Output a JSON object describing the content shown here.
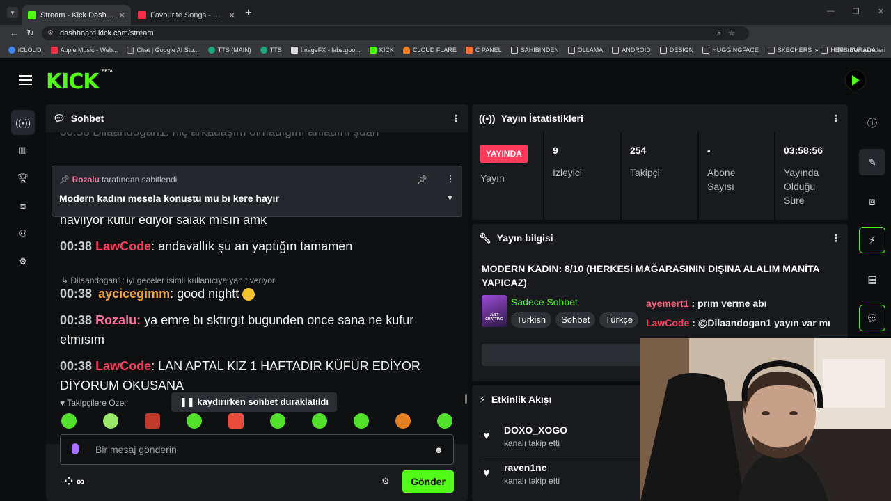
{
  "browser": {
    "tabs": [
      {
        "title": "Stream - Kick Dashboard",
        "active": true
      },
      {
        "title": "Favourite Songs - Playlist - App",
        "active": false
      }
    ],
    "url": "dashboard.kick.com/stream",
    "bookmarks": [
      "iCLOUD",
      "Apple Music - Web...",
      "Chat | Google AI Stu...",
      "TTS (MAIN)",
      "TTS",
      "ImageFX - labs.goo...",
      "KICK",
      "CLOUD FLARE",
      "C PANEL",
      "SAHIBINDEN",
      "OLLAMA",
      "ANDROID",
      "DESIGN",
      "HUGGINGFACE",
      "SKECHERS",
      "HEPSIBURADA"
    ],
    "bookmarks_overflow": "»",
    "all_bookmarks": "Tüm Yer İşaretleri"
  },
  "app": {
    "logo": "KICK",
    "beta": "BETA"
  },
  "chat": {
    "title": "Sohbet",
    "ghost_line": "00:38 Dilaandogan1: hiç arkadaşım olmadığını anladım şuan",
    "pinned": {
      "user": "Rozalu",
      "by_suffix": "tarafından sabitlendi",
      "message": "Modern kadını mesela konustu mu bı kere hayır"
    },
    "messages": [
      {
        "time": "",
        "user": "",
        "color": "#ff3b5c",
        "text": "gelmiyorum şurda gülelim eğlenelim dite geliyorum kız 1 haftadır bana havlıyor küfür ediyor salak mısın amk"
      },
      {
        "time": "00:38",
        "user": "LawCode",
        "color": "#ff3b5c",
        "text": ": andavallık şu an yaptığın tamamen"
      },
      {
        "time": "00:38",
        "user": "aycicegimm",
        "color": "#f2a33a",
        "text": ": good nightt"
      },
      {
        "time": "00:38",
        "user": "Rozalu:",
        "color": "#ff6fa0",
        "text": " ya emre bı sktırgıt bugunden once sana ne kufur etmısım"
      },
      {
        "time": "00:38",
        "user": "LawCode",
        "color": "#ff3b5c",
        "text": ": LAN APTAL KIZ 1 HAFTADIR KÜFÜR EDİYOR DİYORUM OKUSANA"
      }
    ],
    "reply_note": "Dilaandogan1: iyi geceler isimli kullanıcıya yanıt veriyor",
    "paused": "kaydırırken sohbet duraklatıldı",
    "followers_only": "Takipçilere Özel",
    "input_placeholder": "Bir mesaj gönderin",
    "send": "Gönder"
  },
  "stats": {
    "title": "Yayın İstatistikleri",
    "live_badge": "YAYINDA",
    "live_label": "Yayın",
    "viewers": {
      "value": "9",
      "label": "İzleyici"
    },
    "followers": {
      "value": "254",
      "label": "Takipçi"
    },
    "subs": {
      "value": "-",
      "label": "Abone Sayısı"
    },
    "uptime": {
      "value": "03:58:56",
      "label": "Yayında Olduğu Süre"
    }
  },
  "stream_info": {
    "title": "Yayın bilgisi",
    "stream_title": "MODERN KADIN: 8/10 (HERKESİ MAĞARASININ DIŞINA ALALIM MANİTA YAPICAZ)",
    "category": "Sadece Sohbet",
    "thumb_text": "JUST CHATTING",
    "tags": [
      "Turkish",
      "Sohbet",
      "Türkçe"
    ]
  },
  "overlay_chat": [
    {
      "user": "ayemert1",
      "text": " : prım verme abı"
    },
    {
      "user": "LawCode",
      "text": " : @Dilaandogan1 yayın var mı"
    }
  ],
  "activity": {
    "title": "Etkinlik Akışı",
    "items": [
      {
        "name": "DOXO_XOGO",
        "action": "kanalı takip etti"
      },
      {
        "name": "raven1nc",
        "action": "kanalı takip etti"
      }
    ]
  },
  "colors": {
    "accent": "#53fc18",
    "live": "#ff3b5c"
  }
}
